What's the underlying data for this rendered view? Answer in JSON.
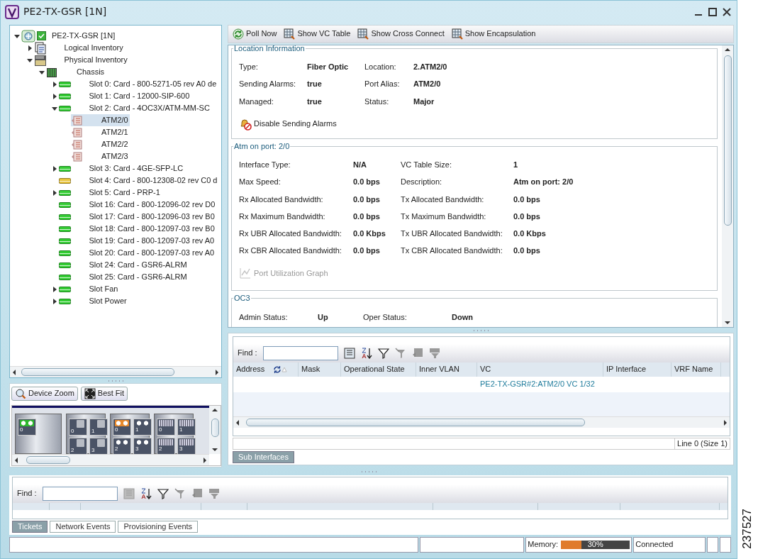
{
  "window": {
    "title": "PE2-TX-GSR [1N]"
  },
  "tree": [
    {
      "label": "PE2-TX-GSR [1N]",
      "kind": "device",
      "expanded": true,
      "selected": false,
      "children": [
        {
          "label": "Logical Inventory",
          "kind": "logical",
          "expanded": false,
          "selected": false
        },
        {
          "label": "Physical Inventory",
          "kind": "physical",
          "expanded": true,
          "selected": false,
          "children": [
            {
              "label": "Chassis",
              "kind": "chassis",
              "expanded": true,
              "selected": false,
              "children": [
                {
                  "label": "Slot 0: Card - 800-5271-05 rev A0 de",
                  "kind": "card",
                  "color": "#33cc33",
                  "expanded": false,
                  "selected": false
                },
                {
                  "label": "Slot 1: Card - 12000-SIP-600",
                  "kind": "card",
                  "color": "#33cc33",
                  "expanded": false,
                  "selected": false
                },
                {
                  "label": "Slot 2: Card - 4OC3X/ATM-MM-SC",
                  "kind": "card",
                  "color": "#33cc33",
                  "expanded": true,
                  "selected": false,
                  "children": [
                    {
                      "label": "ATM2/0",
                      "kind": "port",
                      "selected": true
                    },
                    {
                      "label": "ATM2/1",
                      "kind": "port",
                      "selected": false
                    },
                    {
                      "label": "ATM2/2",
                      "kind": "port",
                      "selected": false
                    },
                    {
                      "label": "ATM2/3",
                      "kind": "port",
                      "selected": false
                    }
                  ]
                },
                {
                  "label": "Slot 3: Card - 4GE-SFP-LC",
                  "kind": "card",
                  "color": "#33cc33",
                  "expanded": false,
                  "selected": false
                },
                {
                  "label": "Slot 4: Card - 800-12308-02 rev C0 d",
                  "kind": "card",
                  "color": "#e8c33a",
                  "selected": false
                },
                {
                  "label": "Slot 5: Card - PRP-1",
                  "kind": "card",
                  "color": "#33cc33",
                  "expanded": false,
                  "selected": false
                },
                {
                  "label": "Slot 16: Card - 800-12096-02 rev D0",
                  "kind": "card",
                  "color": "#33cc33",
                  "selected": false
                },
                {
                  "label": "Slot 17: Card - 800-12096-03 rev B0",
                  "kind": "card",
                  "color": "#33cc33",
                  "selected": false
                },
                {
                  "label": "Slot 18: Card - 800-12097-03 rev B0",
                  "kind": "card",
                  "color": "#33cc33",
                  "selected": false
                },
                {
                  "label": "Slot 19: Card - 800-12097-03 rev A0",
                  "kind": "card",
                  "color": "#33cc33",
                  "selected": false
                },
                {
                  "label": "Slot 20: Card - 800-12097-03 rev A0",
                  "kind": "card",
                  "color": "#33cc33",
                  "selected": false
                },
                {
                  "label": "Slot 24: Card - GSR6-ALRM",
                  "kind": "card",
                  "color": "#33cc33",
                  "selected": false
                },
                {
                  "label": "Slot 25: Card - GSR6-ALRM",
                  "kind": "card",
                  "color": "#33cc33",
                  "selected": false
                },
                {
                  "label": "Slot Fan",
                  "kind": "card",
                  "color": "#33cc33",
                  "expanded": false,
                  "selected": false
                },
                {
                  "label": "Slot Power",
                  "kind": "card",
                  "color": "#33cc33",
                  "expanded": false,
                  "selected": false
                }
              ]
            }
          ]
        }
      ]
    }
  ],
  "device_view": {
    "buttons": [
      {
        "label": "Device Zoom",
        "kind": "zoom"
      },
      {
        "label": "Best Fit",
        "kind": "fit"
      }
    ],
    "cards": [
      {
        "ports": [
          {
            "label": "0",
            "kind": "optical",
            "color": "#2eb82e"
          }
        ]
      },
      {
        "ports": [
          {
            "label": "0",
            "kind": "slot"
          },
          {
            "label": "1",
            "kind": "slot"
          },
          {
            "label": "2",
            "kind": "slot"
          },
          {
            "label": "3",
            "kind": "slot"
          }
        ]
      },
      {
        "ports": [
          {
            "label": "0",
            "kind": "optical",
            "color": "#e8892c"
          },
          {
            "label": "1",
            "kind": "optical",
            "color": "#4a5366"
          },
          {
            "label": "2",
            "kind": "optical",
            "color": "#4a5366"
          },
          {
            "label": "3",
            "kind": "optical",
            "color": "#4a5366"
          }
        ]
      },
      {
        "ports": [
          {
            "label": "0",
            "kind": "rj45"
          },
          {
            "label": "1",
            "kind": "rj45"
          },
          {
            "label": "2",
            "kind": "rj45"
          },
          {
            "label": "3",
            "kind": "rj45"
          }
        ]
      }
    ]
  },
  "toolbar": [
    {
      "label": "Poll Now",
      "kind": "poll"
    },
    {
      "label": "Show VC Table",
      "kind": "show"
    },
    {
      "label": "Show Cross Connect",
      "kind": "show"
    },
    {
      "label": "Show Encapsulation",
      "kind": "show"
    }
  ],
  "sections": [
    {
      "title": "Location Information",
      "fields": [
        {
          "label": "Type:",
          "value": "Fiber Optic"
        },
        {
          "label": "Location:",
          "value": "2.ATM2/0"
        },
        {
          "label": "Sending Alarms:",
          "value": "true"
        },
        {
          "label": "Port Alias:",
          "value": "ATM2/0"
        },
        {
          "label": "Managed:",
          "value": "true"
        },
        {
          "label": "Status:",
          "value": "Major"
        }
      ],
      "action": {
        "label": "Disable Sending Alarms",
        "kind": "alarm",
        "disabled": false
      }
    },
    {
      "title": "Atm on port: 2/0",
      "fields": [
        {
          "label": "Interface Type:",
          "value": "N/A"
        },
        {
          "label": "VC Table Size:",
          "value": "1"
        },
        {
          "label": "Max Speed:",
          "value": "0.0 bps"
        },
        {
          "label": "Description:",
          "value": "Atm on port: 2/0"
        },
        {
          "label": "Rx Allocated Bandwidth:",
          "value": "0.0 bps"
        },
        {
          "label": "Tx Allocated Bandwidth:",
          "value": "0.0 bps"
        },
        {
          "label": "Rx Maximum Bandwidth:",
          "value": "0.0 bps"
        },
        {
          "label": "Tx Maximum Bandwidth:",
          "value": "0.0 bps"
        },
        {
          "label": "Rx UBR Allocated Bandwidth:",
          "value": "0.0 Kbps"
        },
        {
          "label": "Tx UBR Allocated Bandwidth:",
          "value": "0.0 Kbps"
        },
        {
          "label": "Rx CBR Allocated Bandwidth:",
          "value": "0.0 bps"
        },
        {
          "label": "Tx CBR Allocated Bandwidth:",
          "value": "0.0 bps"
        }
      ],
      "action": {
        "label": "Port Utilization Graph",
        "kind": "graph",
        "disabled": true
      }
    },
    {
      "title": "OC3",
      "fields": [
        {
          "label": "Admin Status:",
          "value": "Up"
        },
        {
          "label": "Oper Status:",
          "value": "Down"
        }
      ]
    }
  ],
  "sub_interfaces": {
    "find_label": "Find :",
    "columns": [
      "Address",
      "Mask",
      "Operational State",
      "Inner VLAN",
      "VC",
      "IP Interface",
      "VRF Name"
    ],
    "rows": [
      {
        "vc": "PE2-TX-GSR#2:ATM2/0 VC 1/32"
      }
    ],
    "status": "Line 0 (Size 1)",
    "tabs": [
      {
        "label": "Sub Interfaces",
        "selected": true
      }
    ]
  },
  "events": {
    "find_label": "Find :",
    "tabs": [
      {
        "label": "Tickets",
        "selected": true
      },
      {
        "label": "Network Events",
        "selected": false
      },
      {
        "label": "Provisioning Events",
        "selected": false
      }
    ]
  },
  "status_bar": {
    "memory_label": "Memory:",
    "memory": {
      "level": 0.3,
      "reading": "30%"
    },
    "connection": "Connected"
  },
  "figure_id": "237527"
}
